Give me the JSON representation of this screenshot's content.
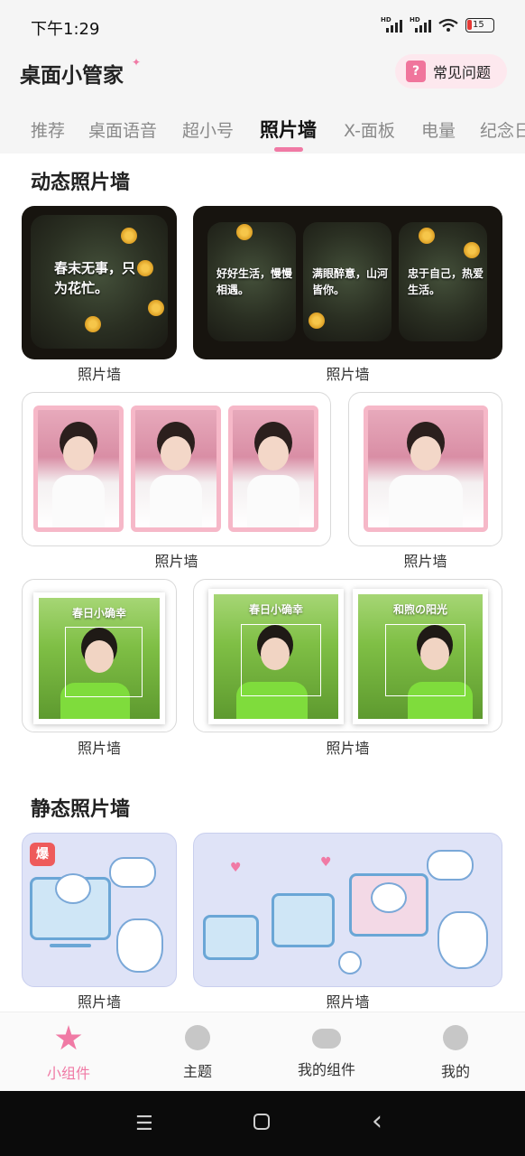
{
  "status_bar": {
    "time": "下午1:29",
    "battery": "15",
    "battery_color": "#e53935",
    "icons": [
      "mute-icon",
      "signal-icon",
      "signal-icon",
      "wifi-icon",
      "battery-icon"
    ]
  },
  "header": {
    "title": "桌面小管家",
    "faq_label": "常见问题",
    "faq_icon": "?",
    "accent_color": "#f07aa5"
  },
  "tabs": [
    {
      "label": "推荐"
    },
    {
      "label": "桌面语音"
    },
    {
      "label": "超小号"
    },
    {
      "label": "照片墙",
      "active": true
    },
    {
      "label": "X-面板"
    },
    {
      "label": "电量"
    },
    {
      "label": "纪念日"
    }
  ],
  "sections": {
    "dynamic_title": "动态照片墙",
    "static_title": "静态照片墙"
  },
  "cards": {
    "label": "照片墙",
    "dark_poems": [
      "春末无事，只为花忙。",
      "好好生活，慢慢相遇。",
      "满眼醉意，山河皆你。",
      "忠于自己，热爱生活。"
    ],
    "green_captions": [
      "春日小确幸",
      "春日小确幸",
      "和煦の阳光"
    ],
    "hot_badge": "爆"
  },
  "bottom_nav": [
    {
      "label": "小组件",
      "icon": "star-icon",
      "active": true
    },
    {
      "label": "主题",
      "icon": "heart-wave-icon"
    },
    {
      "label": "我的组件",
      "icon": "cloud-icon"
    },
    {
      "label": "我的",
      "icon": "smiley-icon"
    }
  ],
  "system_nav": {
    "menu": "☰",
    "back": "‹"
  }
}
